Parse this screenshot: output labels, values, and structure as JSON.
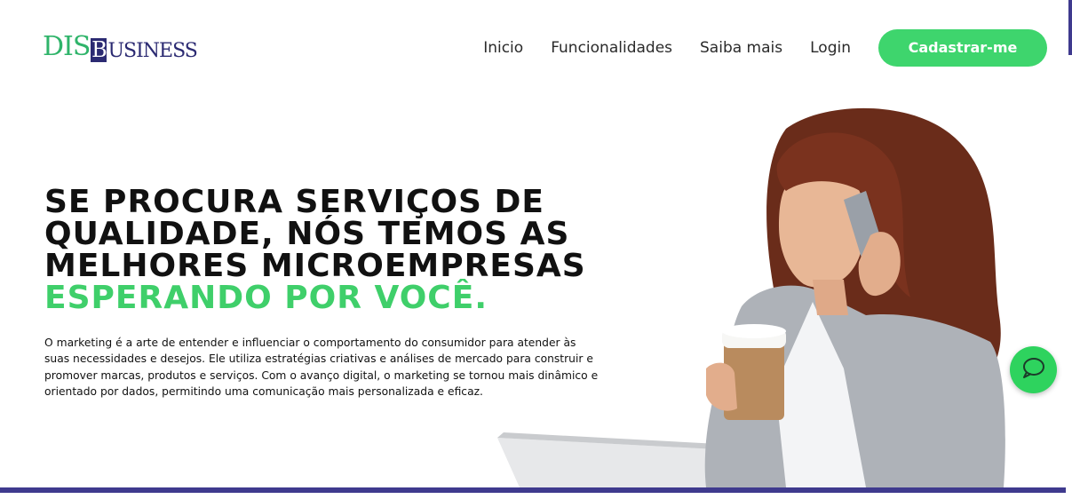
{
  "header": {
    "logo": {
      "part1": "DIS",
      "mark": "B",
      "part2": "USINESS"
    },
    "nav": [
      {
        "label": "Inicio"
      },
      {
        "label": "Funcionalidades"
      },
      {
        "label": "Saiba mais"
      },
      {
        "label": "Login"
      }
    ],
    "cta_label": "Cadastrar-me"
  },
  "hero": {
    "headline_lines": [
      "SE PROCURA SERVIÇOS DE",
      "QUALIDADE, NÓS TEMOS AS",
      "MELHORES MICROEMPRESAS"
    ],
    "headline_accent": "ESPERANDO POR VOCÊ.",
    "description": "O marketing é a arte de entender e influenciar o comportamento do consumidor para atender às suas necessidades e desejos. Ele utiliza estratégias criativas e análises de mercado para construir e promover marcas, produtos e serviços. Com o avanço digital, o marketing se tornou mais dinâmico e orientado por dados, permitindo uma comunicação mais personalizada e eficaz."
  },
  "chat": {
    "icon": "chat-bubble-icon"
  },
  "colors": {
    "accent_green": "#3ed56d",
    "brand_navy": "#2b2a72",
    "bar_indigo": "#3f3a8e"
  }
}
